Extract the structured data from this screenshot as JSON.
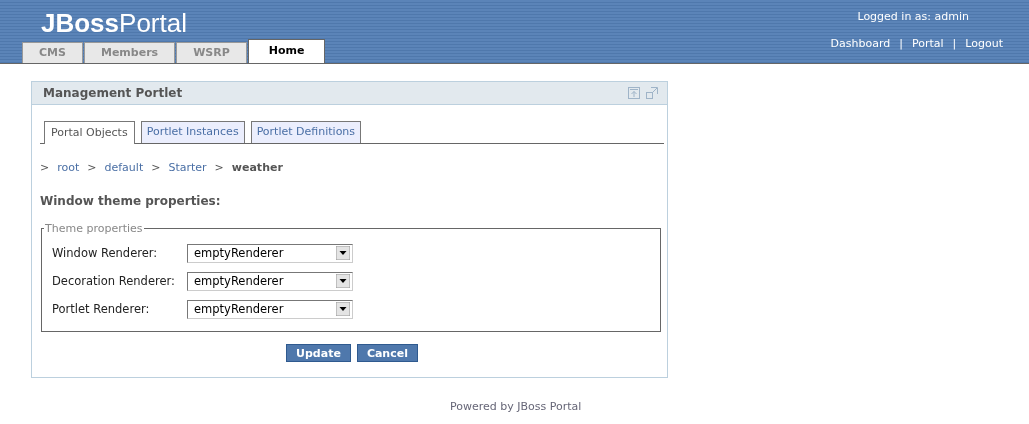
{
  "header": {
    "logo": "**JBoss**Portal",
    "user": "Logged in as: admin",
    "links": [
      "Dashboard",
      "Portal",
      "Logout"
    ],
    "separators": [
      "|",
      "|"
    ]
  },
  "nav_tabs": [
    {
      "label": "CMS",
      "selected": false
    },
    {
      "label": "Members",
      "selected": false
    },
    {
      "label": "WSRP",
      "selected": false
    },
    {
      "label": "Home",
      "selected": true
    }
  ],
  "portlet": {
    "title": "Management Portlet",
    "tabs": [
      {
        "label": "Portal Objects",
        "selected": true
      },
      {
        "label": "Portlet Instances",
        "selected": false
      },
      {
        "label": "Portlet Definitions",
        "selected": false
      }
    ],
    "breadcrumb": [
      {
        "label": "root",
        "current": false
      },
      {
        "label": "default",
        "current": false
      },
      {
        "label": "Starter",
        "current": false
      },
      {
        "label": "weather",
        "current": true
      }
    ],
    "breadcrumb_separator": ">",
    "heading": "Window theme properties:",
    "fieldset": {
      "legend": "Theme properties",
      "fields": [
        {
          "label": "Window Renderer:",
          "value": "emptyRenderer"
        },
        {
          "label": "Decoration Renderer:",
          "value": "emptyRenderer"
        },
        {
          "label": "Portlet Renderer:",
          "value": "emptyRenderer"
        }
      ]
    },
    "buttons": [
      "Update",
      "Cancel"
    ]
  },
  "footer": "Powered by JBoss Portal"
}
